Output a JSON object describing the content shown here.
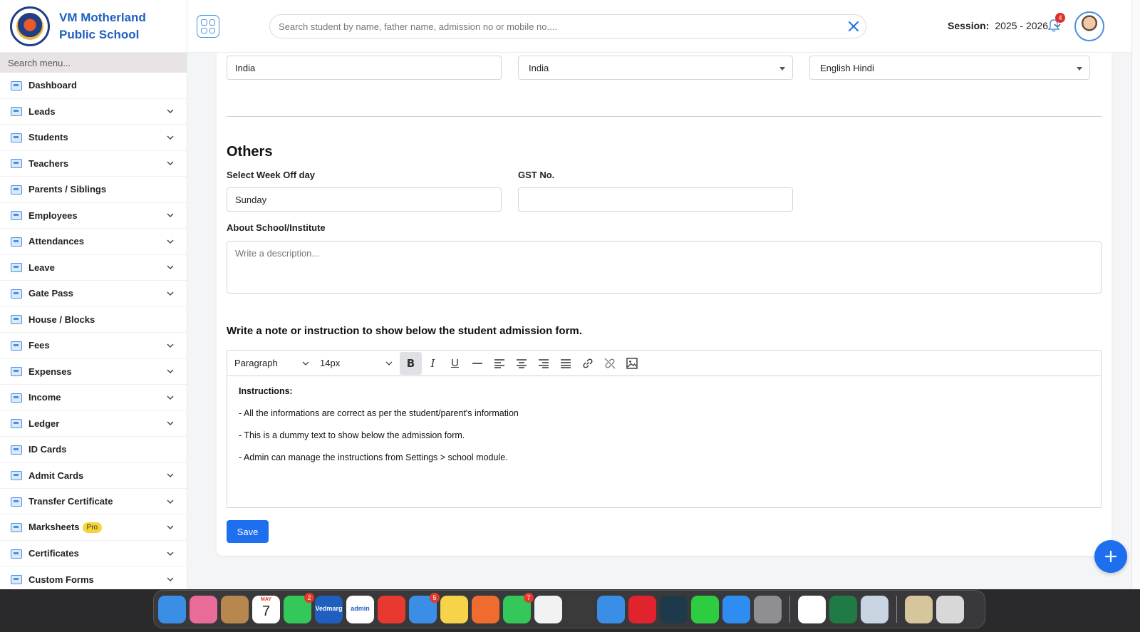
{
  "school": {
    "name_line1": "VM Motherland",
    "name_line2": "Public School"
  },
  "sidebar": {
    "search_placeholder": "Search menu...",
    "items": [
      {
        "label": "Dashboard",
        "icon": "home-icon",
        "expandable": false
      },
      {
        "label": "Leads",
        "icon": "leads-icon",
        "expandable": true
      },
      {
        "label": "Students",
        "icon": "students-icon",
        "expandable": true
      },
      {
        "label": "Teachers",
        "icon": "teachers-icon",
        "expandable": true
      },
      {
        "label": "Parents / Siblings",
        "icon": "parents-icon",
        "expandable": false
      },
      {
        "label": "Employees",
        "icon": "employees-icon",
        "expandable": true
      },
      {
        "label": "Attendances",
        "icon": "attendance-icon",
        "expandable": true
      },
      {
        "label": "Leave",
        "icon": "leave-icon",
        "expandable": true
      },
      {
        "label": "Gate Pass",
        "icon": "gate-pass-icon",
        "expandable": true
      },
      {
        "label": "House / Blocks",
        "icon": "house-icon",
        "expandable": false
      },
      {
        "label": "Fees",
        "icon": "fees-icon",
        "expandable": true
      },
      {
        "label": "Expenses",
        "icon": "expenses-icon",
        "expandable": true
      },
      {
        "label": "Income",
        "icon": "income-icon",
        "expandable": true
      },
      {
        "label": "Ledger",
        "icon": "ledger-icon",
        "expandable": true
      },
      {
        "label": "ID Cards",
        "icon": "id-card-icon",
        "expandable": false
      },
      {
        "label": "Admit Cards",
        "icon": "admit-card-icon",
        "expandable": true
      },
      {
        "label": "Transfer Certificate",
        "icon": "certificate-icon",
        "expandable": true
      },
      {
        "label": "Marksheets",
        "icon": "marksheet-icon",
        "expandable": true,
        "badge": "Pro"
      },
      {
        "label": "Certificates",
        "icon": "certificates-icon",
        "expandable": true
      },
      {
        "label": "Custom Forms",
        "icon": "forms-icon",
        "expandable": true
      }
    ]
  },
  "header": {
    "search_placeholder": "Search student by name, father name, admission no or mobile no....",
    "session_label": "Session:",
    "session_value": "2025 - 2026",
    "notification_count": "4"
  },
  "form": {
    "country_value": "India",
    "country_select": "India",
    "language_select": "English Hindi",
    "section_title": "Others",
    "week_off_label": "Select Week Off day",
    "week_off_value": "Sunday",
    "gst_label": "GST No.",
    "gst_value": "",
    "about_label": "About School/Institute",
    "about_placeholder": "Write a description...",
    "note_title": "Write a note or instruction to show below the student admission form.",
    "save_label": "Save"
  },
  "editor": {
    "block_format": "Paragraph",
    "font_size": "14px",
    "heading": "Instructions:",
    "lines": [
      "- All the informations are correct as per the student/parent's information",
      "- This is a dummy text to show below the admission form.",
      "- Admin can manage the instructions from Settings > school module."
    ]
  },
  "dock": {
    "apps": [
      {
        "name": "finder",
        "color": "#3a8ee6"
      },
      {
        "name": "launchpad",
        "color": "#e96b9a"
      },
      {
        "name": "contacts",
        "color": "#b8874d"
      },
      {
        "name": "calendar",
        "color": "#ffffff",
        "month": "MAY",
        "day": "7"
      },
      {
        "name": "facetime",
        "color": "#34c759",
        "badge": "2"
      },
      {
        "name": "vedmarg",
        "color": "#1f5fbf",
        "text": "Vedmarg"
      },
      {
        "name": "vedmarg-admin",
        "color": "#ffffff",
        "text": "admin"
      },
      {
        "name": "anydesk",
        "color": "#e8392e"
      },
      {
        "name": "mail",
        "color": "#3a8ee6",
        "badge": "5"
      },
      {
        "name": "notes",
        "color": "#f7d34a"
      },
      {
        "name": "firefox",
        "color": "#ef6b2e"
      },
      {
        "name": "whatsapp",
        "color": "#34c759",
        "badge": "7"
      },
      {
        "name": "chrome",
        "color": "#f2f2f2"
      },
      {
        "name": "sublime",
        "color": "#3b3b3b"
      },
      {
        "name": "safari",
        "color": "#3a8ee6"
      },
      {
        "name": "opera",
        "color": "#e0232c"
      },
      {
        "name": "filmora",
        "color": "#1e3a4a"
      },
      {
        "name": "pen",
        "color": "#2ecc40"
      },
      {
        "name": "app-store",
        "color": "#2f8cf0"
      },
      {
        "name": "settings",
        "color": "#8e8e93"
      },
      {
        "name": "windows",
        "color": "#ffffff"
      },
      {
        "name": "excel",
        "color": "#1f7a45"
      },
      {
        "name": "preview",
        "color": "#c9d4e3"
      },
      {
        "name": "archive",
        "color": "#d7c59b"
      },
      {
        "name": "trash",
        "color": "#d8d8d8"
      }
    ]
  },
  "colors": {
    "accent": "#1e6ff0",
    "brand": "#1f5fbf",
    "icon": "#4b8fe0"
  }
}
